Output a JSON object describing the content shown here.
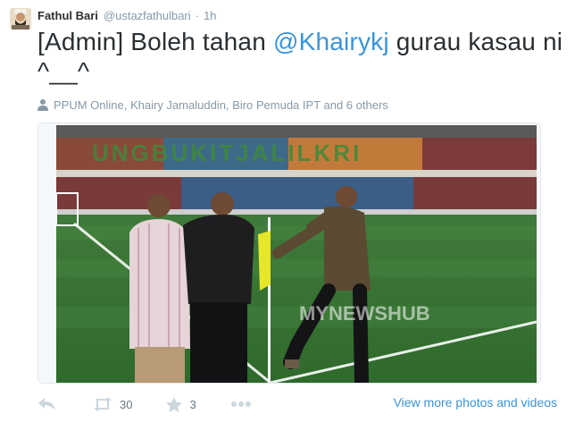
{
  "tweet": {
    "fullname": "Fathul Bari",
    "username": "@ustazfathulbari",
    "separator": "·",
    "time": "1h",
    "text_before": "[Admin] Boleh tahan ",
    "mention": "@Khairykj",
    "text_after": " gurau kasau ni ^__^",
    "context_line": "PPUM Online, Khairy Jamaluddin, Biro Pemuda IPT and 6 others",
    "photo": {
      "watermark": "MYNEWSHUB",
      "stadium_banner_letters": "UNGBUKITJALILKRI"
    }
  },
  "actions": {
    "retweet_count": "30",
    "favorite_count": "3",
    "view_more": "View more photos and videos"
  },
  "icons": {
    "reply": "reply-icon",
    "retweet": "retweet-icon",
    "favorite": "star-icon",
    "more": "more-dots-icon",
    "person": "person-icon"
  },
  "colors": {
    "link": "#3b94d9",
    "muted": "#8899a6",
    "action_icon": "#ccd6dd"
  }
}
